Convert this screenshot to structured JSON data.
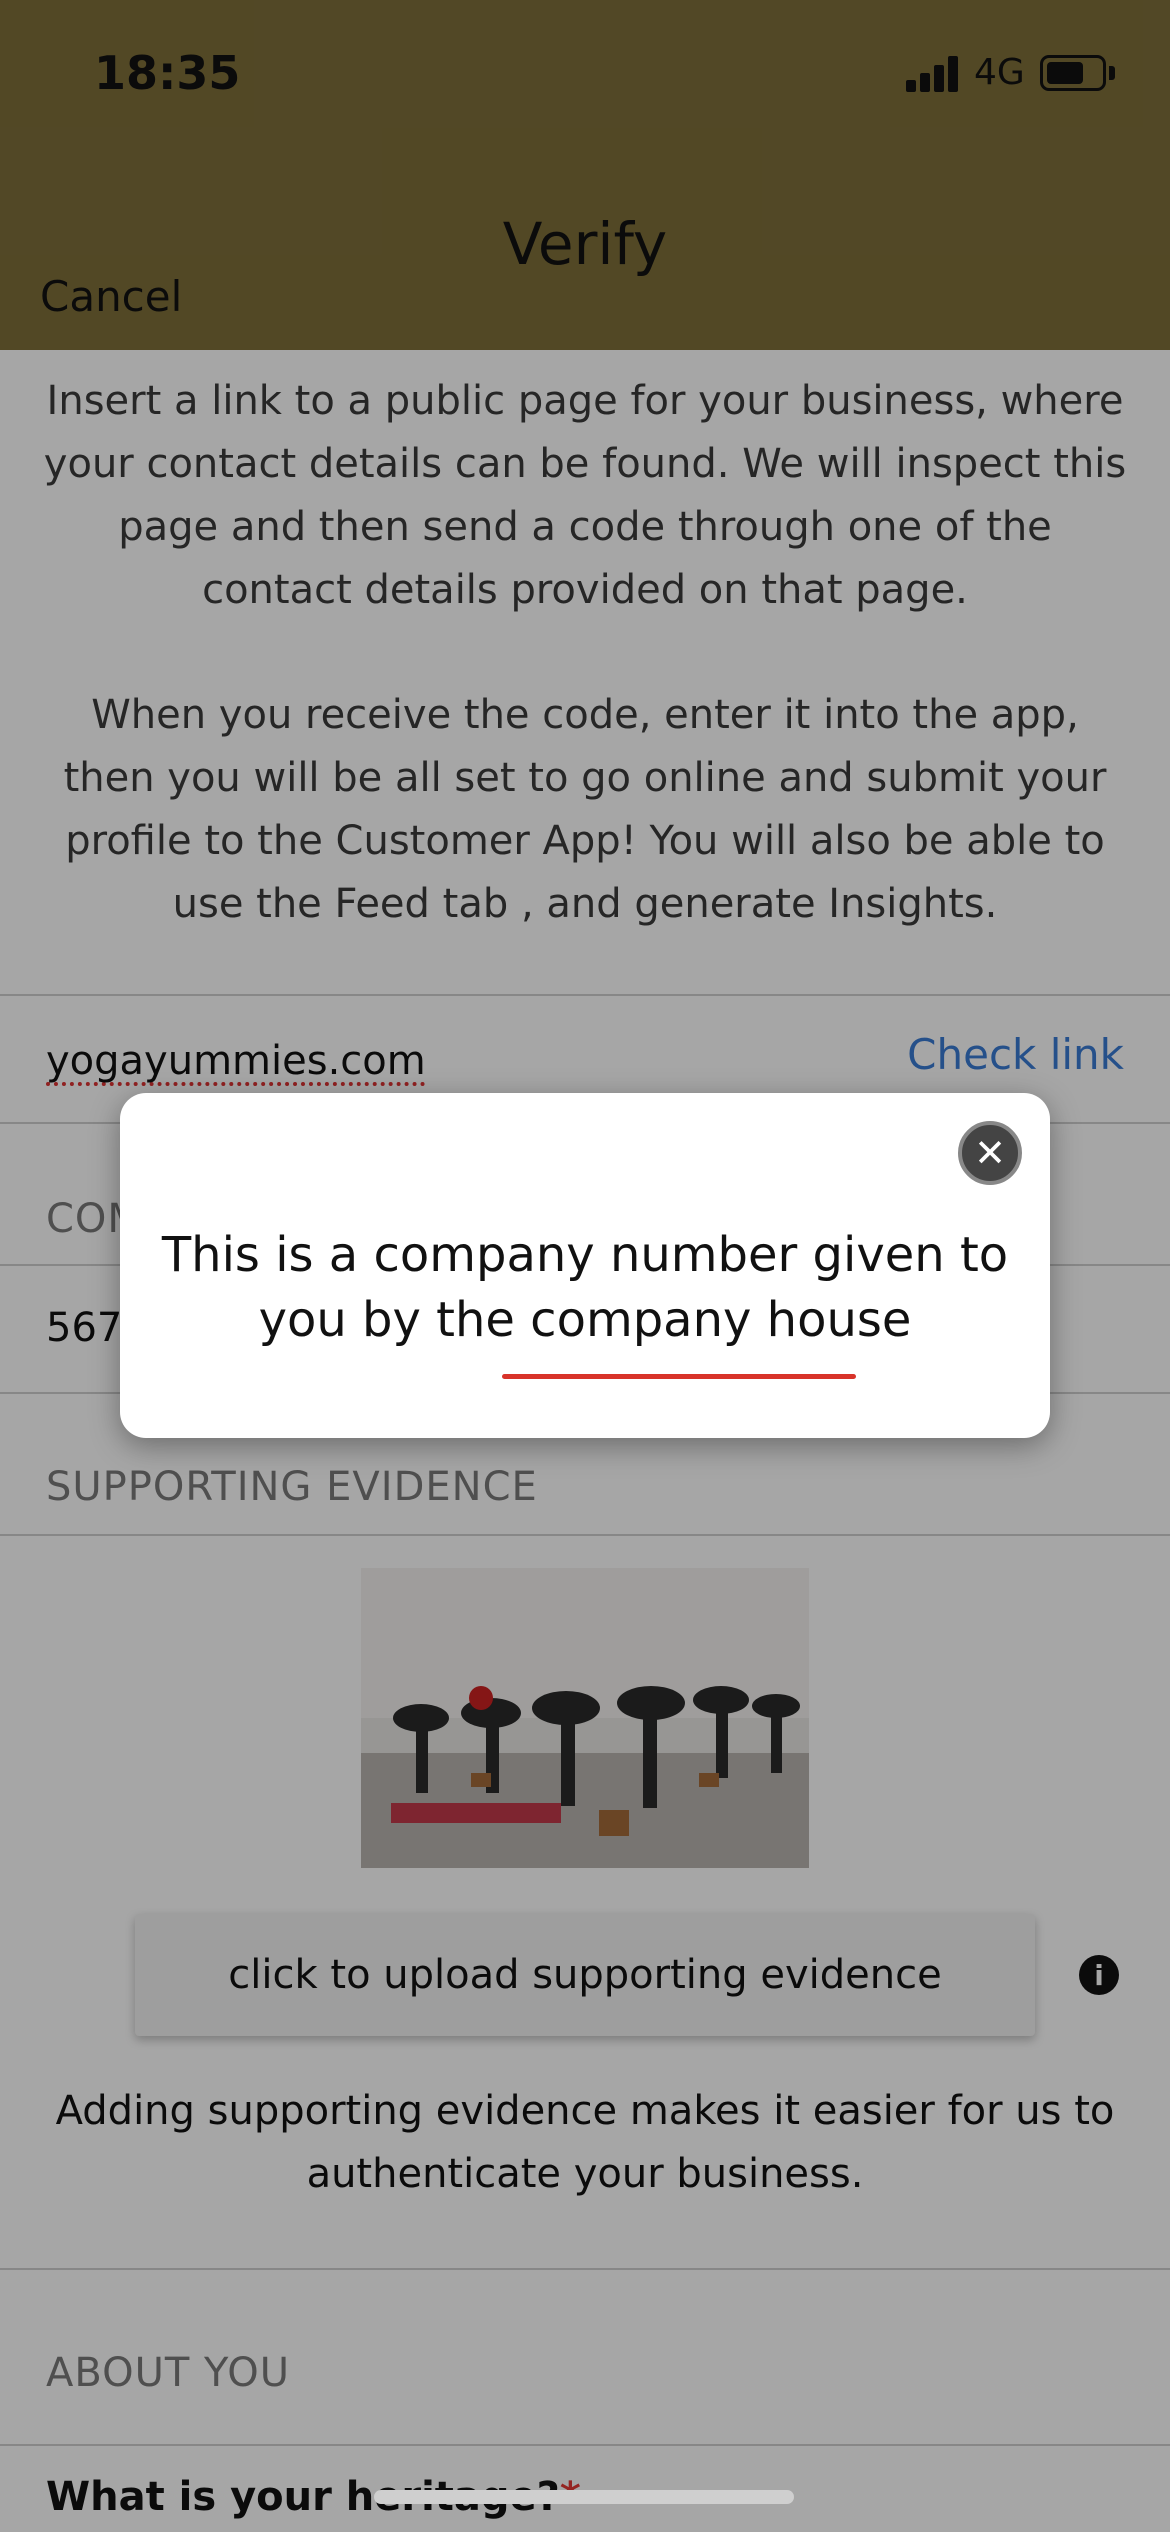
{
  "status_bar": {
    "time": "18:35",
    "network": "4G"
  },
  "nav": {
    "title": "Verify",
    "cancel_label": "Cancel"
  },
  "intro": {
    "paragraph1": "Insert a link to a public page for your business, where your contact details can be found. We will inspect this page and then send a code through one of the contact details provided on that page.",
    "paragraph2": "When you receive the code, enter it into the app, then you will be all set to go online and submit your profile to the Customer App! You will also be able to use the Feed tab , and generate Insights."
  },
  "website": {
    "value": "yogayummies.com",
    "check_label": "Check link"
  },
  "company_number": {
    "section_title_partial": "COM",
    "value_partial": "567"
  },
  "supporting_evidence": {
    "section_title": "SUPPORTING EVIDENCE",
    "upload_label": "click to upload supporting evidence",
    "info_icon": "info-icon",
    "note": "Adding supporting evidence makes it easier for us to authenticate your business."
  },
  "about_you": {
    "section_title": "ABOUT YOU",
    "heritage_question": "What is your heritage?",
    "required_marker": "*"
  },
  "modal": {
    "text": "This is a company number given to you by the company house",
    "close_icon": "close-icon"
  },
  "colors": {
    "header": "#7e6f3a",
    "link": "#3a7bd5",
    "required": "#e53935",
    "underline": "#d8332a"
  }
}
